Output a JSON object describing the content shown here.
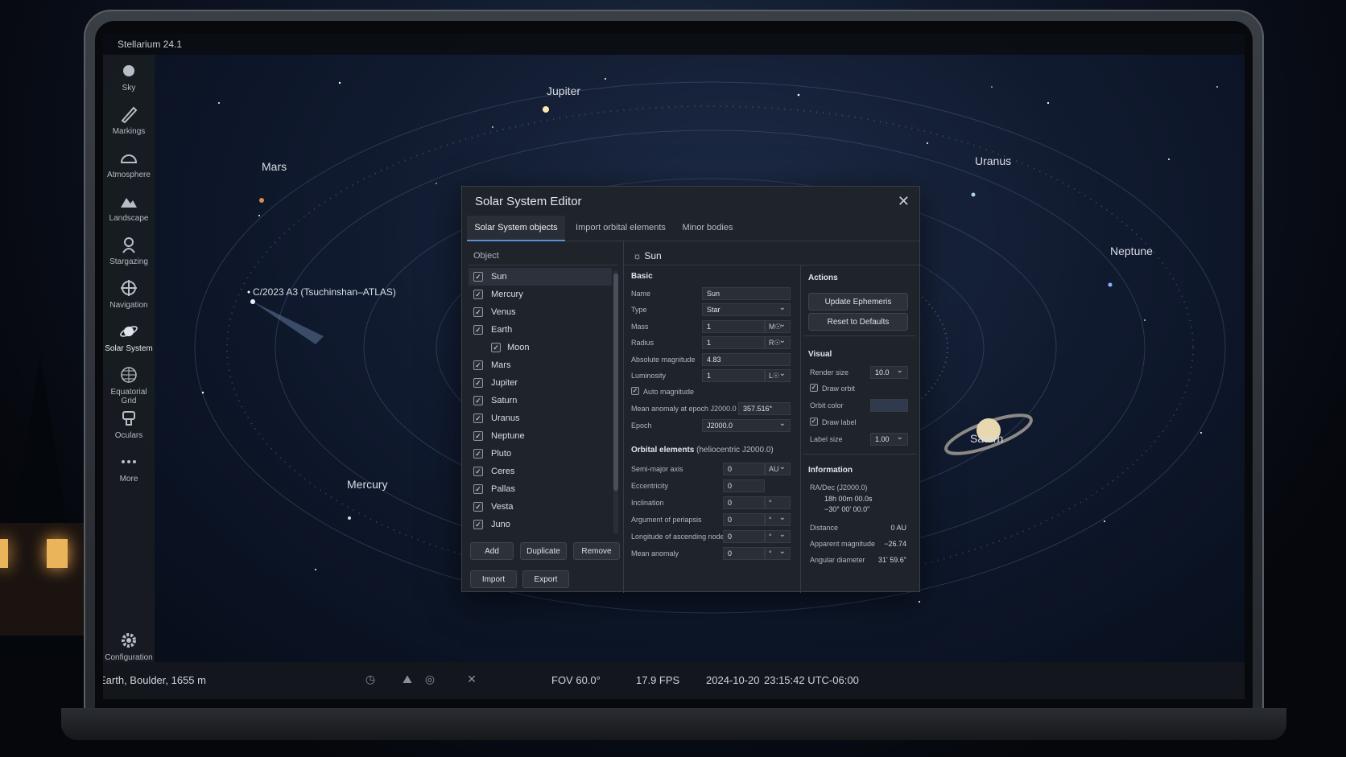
{
  "app": {
    "title": "Stellarium 24.1"
  },
  "sidebar": {
    "items": [
      {
        "label": "Sky",
        "icon": "sun-icon"
      },
      {
        "label": "Markings",
        "icon": "pen-icon"
      },
      {
        "label": "Atmosphere",
        "icon": "atmosphere-icon"
      },
      {
        "label": "Landscape",
        "icon": "mountain-icon"
      },
      {
        "label": "Stargazing",
        "icon": "stargazing-icon"
      },
      {
        "label": "Navigation",
        "icon": "compass-icon"
      },
      {
        "label": "Solar System",
        "icon": "planet-icon"
      },
      {
        "label": "Equatorial Grid",
        "icon": "grid-icon"
      },
      {
        "label": "Oculars",
        "icon": "ocular-icon"
      },
      {
        "label": "More",
        "icon": "more-icon"
      }
    ],
    "config_label": "Configuration"
  },
  "sky": {
    "labels": {
      "jupiter": "Jupiter",
      "mars": "Mars",
      "uranus": "Uranus",
      "neptune": "Neptune",
      "comet": "C/2023 A3 (Tsuchinshan–ATLAS)",
      "mercury": "Mercury",
      "saturn": "Saturn"
    }
  },
  "statusbar": {
    "location": "Earth, Boulder, 1655 m",
    "fov": "FOV 60.0°",
    "fps": "17.9 FPS",
    "date": "2024-10-20",
    "time": "23:15:42 UTC-06:00"
  },
  "dialog": {
    "title": "Solar System Editor",
    "tabs": [
      "Solar System objects",
      "Import orbital elements",
      "Minor bodies"
    ],
    "object_header": "Object",
    "objects": [
      {
        "name": "Sun",
        "child": false
      },
      {
        "name": "Mercury",
        "child": false
      },
      {
        "name": "Venus",
        "child": false
      },
      {
        "name": "Earth",
        "child": false
      },
      {
        "name": "Moon",
        "child": true
      },
      {
        "name": "Mars",
        "child": false
      },
      {
        "name": "Jupiter",
        "child": false
      },
      {
        "name": "Saturn",
        "child": false
      },
      {
        "name": "Uranus",
        "child": false
      },
      {
        "name": "Neptune",
        "child": false
      },
      {
        "name": "Pluto",
        "child": false
      },
      {
        "name": "Ceres",
        "child": false
      },
      {
        "name": "Pallas",
        "child": false
      },
      {
        "name": "Vesta",
        "child": false
      },
      {
        "name": "Juno",
        "child": false
      }
    ],
    "buttons": {
      "add": "Add",
      "duplicate": "Duplicate",
      "remove": "Remove",
      "import": "Import",
      "export": "Export"
    },
    "selected": "Sun",
    "basic": {
      "title": "Basic",
      "name_label": "Name",
      "name_value": "Sun",
      "type_label": "Type",
      "type_value": "Star",
      "mass_label": "Mass",
      "mass_value": "1",
      "mass_unit": "M☉",
      "radius_label": "Radius",
      "radius_value": "1",
      "radius_unit": "R☉",
      "absmag_label": "Absolute magnitude",
      "absmag_value": "4.83",
      "lum_label": "Luminosity",
      "lum_value": "1",
      "lum_unit": "L☉",
      "automag_label": "Auto magnitude",
      "meananom_label": "Mean anomaly at epoch J2000.0",
      "meananom_value": "357.516°",
      "epoch_label": "Epoch",
      "epoch_value": "J2000.0"
    },
    "orbital": {
      "title": "Orbital elements",
      "subtitle": "(heliocentric J2000.0)",
      "rows": [
        {
          "label": "Semi-major axis",
          "value": "0",
          "unit": "AU"
        },
        {
          "label": "Eccentricity",
          "value": "0",
          "unit": ""
        },
        {
          "label": "Inclination",
          "value": "0",
          "unit": "°"
        },
        {
          "label": "Argument of periapsis",
          "value": "0",
          "unit": "°"
        },
        {
          "label": "Longitude of ascending node",
          "value": "0",
          "unit": "°"
        },
        {
          "label": "Mean anomaly",
          "value": "0",
          "unit": "°"
        }
      ]
    },
    "actions": {
      "title": "Actions",
      "update": "Update Ephemeris",
      "reset": "Reset to Defaults"
    },
    "visual": {
      "title": "Visual",
      "render_size_label": "Render size",
      "render_size_value": "10.0",
      "draw_orbit_label": "Draw orbit",
      "orbit_color_label": "Orbit color",
      "orbit_color": "#2f3a4d",
      "draw_label_label": "Draw label",
      "label_size_label": "Label size",
      "label_size_value": "1.00"
    },
    "info": {
      "title": "Information",
      "radec_label": "RA/Dec (J2000.0)",
      "ra": "18h 00m 00.0s",
      "dec": "−30° 00' 00.0\"",
      "distance_label": "Distance",
      "distance_value": "0 AU",
      "appmag_label": "Apparent magnitude",
      "appmag_value": "−26.74",
      "angdiam_label": "Angular diameter",
      "angdiam_value": "31' 59.6\""
    }
  }
}
